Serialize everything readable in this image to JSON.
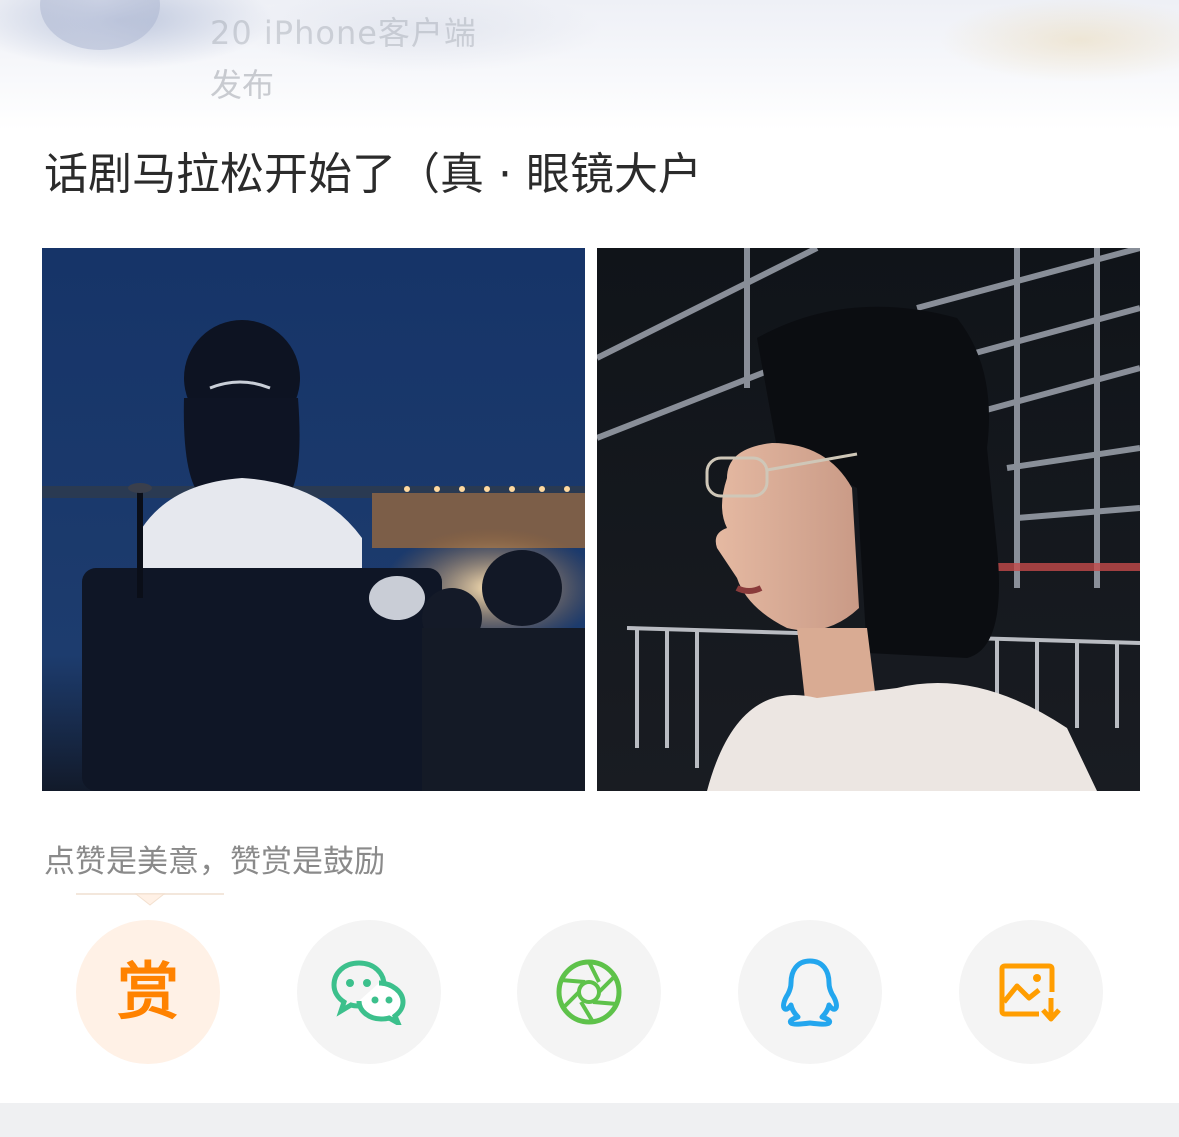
{
  "header": {
    "meta_line": "20        iPhone客户端",
    "meta_line2": "发布"
  },
  "post": {
    "text": "话剧马拉松开始了（真 · 眼镜大户"
  },
  "photos": [
    {
      "name": "photo-back-view"
    },
    {
      "name": "photo-profile-glasses"
    }
  ],
  "reward": {
    "hint": "点赞是美意，赞赏是鼓励",
    "glyph": "赏"
  },
  "share": {
    "buttons": [
      {
        "name": "reward-button",
        "icon": "reward-icon"
      },
      {
        "name": "wechat-share-button",
        "icon": "wechat-icon"
      },
      {
        "name": "moments-share-button",
        "icon": "moments-aperture-icon"
      },
      {
        "name": "qq-share-button",
        "icon": "qq-penguin-icon"
      },
      {
        "name": "save-image-button",
        "icon": "save-image-icon"
      }
    ],
    "colors": {
      "reward": "#ff8200",
      "wechat": "#3cc08c",
      "moments": "#5ec24a",
      "qq": "#23a6ee",
      "save": "#ff9d00"
    }
  }
}
